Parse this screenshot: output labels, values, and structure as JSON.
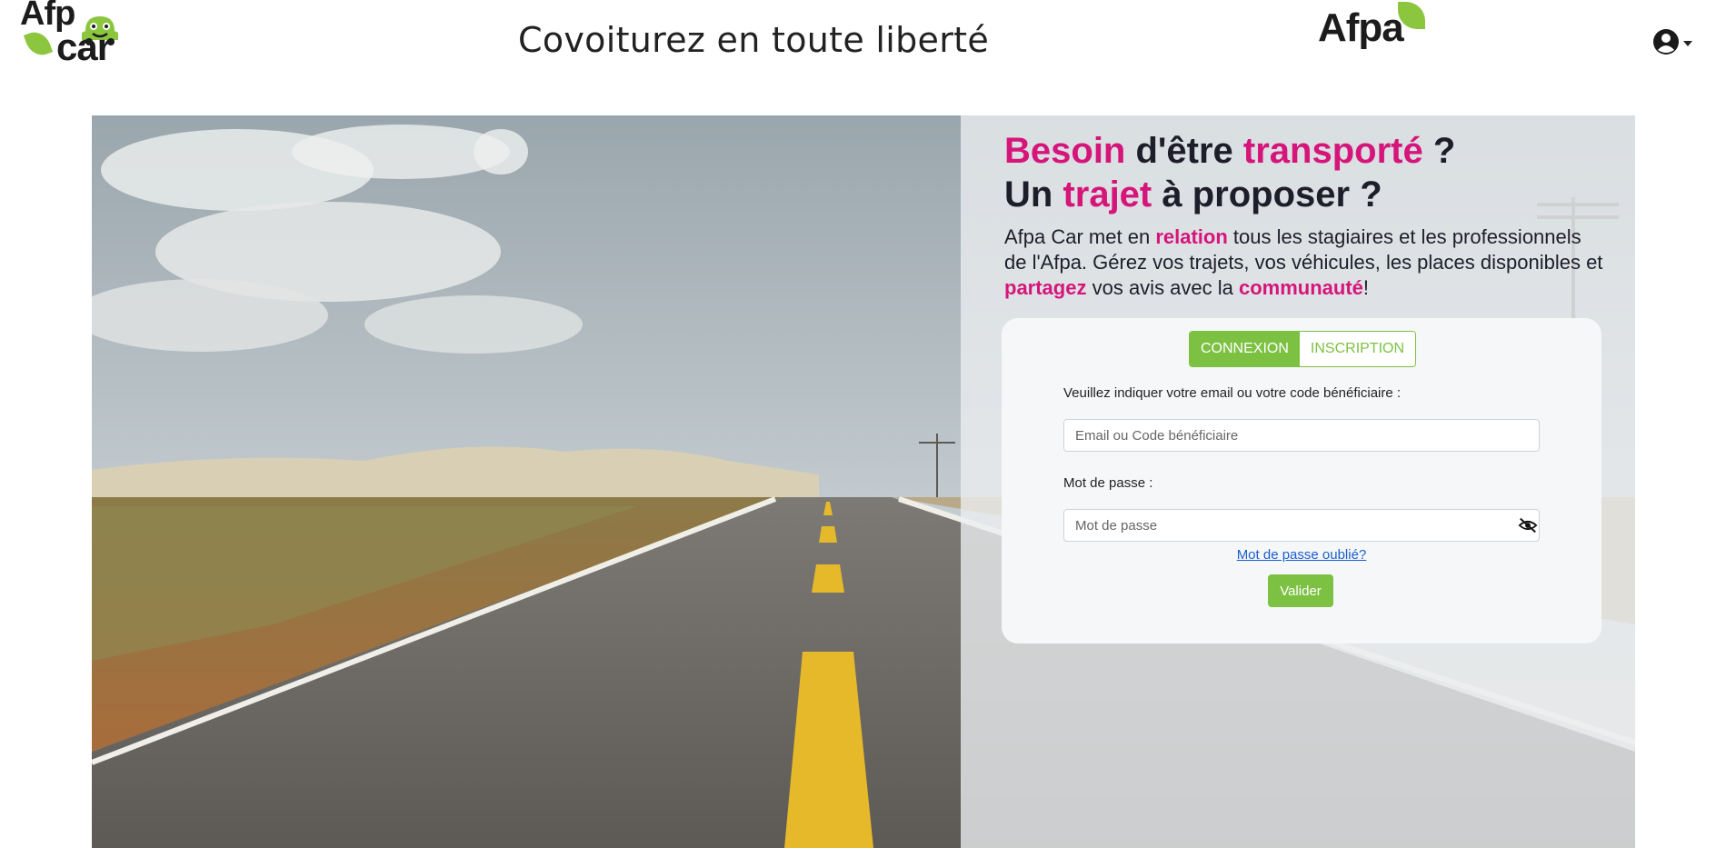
{
  "header": {
    "logo_left_line1": "Afp",
    "logo_left_line2": "car",
    "title": "Covoiturez en toute liberté",
    "logo_right": "Afpa",
    "brand_green": "#8cc63f",
    "brand_pink": "#d6157a"
  },
  "hero": {
    "headline_line1": {
      "a": "Besoin",
      "b": " d'être ",
      "c": "transporté",
      "d": " ?"
    },
    "headline_line2": {
      "a": "Un ",
      "b": "trajet",
      "c": " à proposer ?"
    },
    "intro": {
      "p1": "Afpa Car met en ",
      "k1": "relation",
      "p2": " tous les stagiaires et les professionnels de l'Afpa. Gérez vos trajets, vos véhicules, les places disponibles et ",
      "k2": "partagez",
      "p3": " vos avis avec la ",
      "k3": "communauté",
      "p4": "!"
    }
  },
  "login": {
    "tab_login": "CONNEXION",
    "tab_register": "INSCRIPTION",
    "email_label": "Veuillez indiquer votre email ou votre code bénéficiaire :",
    "email_placeholder": "Email ou Code bénéficiaire",
    "password_label": "Mot de passe :",
    "password_placeholder": "Mot de passe",
    "forgot_link": "Mot de passe oublié?",
    "submit_label": "Valider"
  }
}
